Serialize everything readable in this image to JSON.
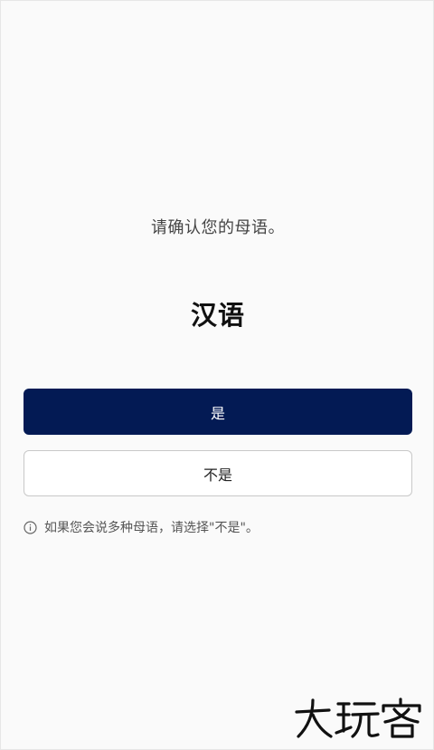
{
  "dialog": {
    "prompt": "请确认您的母语。",
    "language": "汉语",
    "yes_label": "是",
    "no_label": "不是",
    "hint": "如果您会说多种母语，请选择\"不是\"。"
  },
  "watermark": {
    "text": "大玩客"
  },
  "colors": {
    "primary": "#031a54",
    "background": "#fafafa"
  }
}
